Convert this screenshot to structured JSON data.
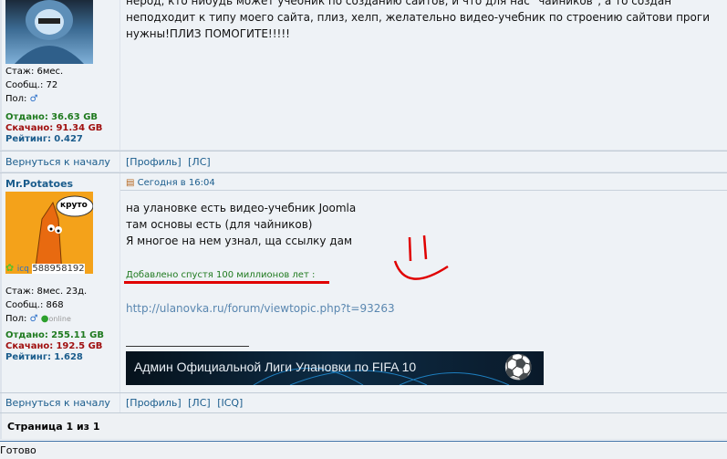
{
  "post1": {
    "text_line1": "нерод, кто нибудь может учебник по созданию сайтов, и что для нас \"чайников\", а то создан",
    "text_line2": "неподходит к типу моего сайта, плиз, хелп, желательно видео-учебник по строению сайтови проги",
    "text_line3": "нужны!ПЛИЗ ПОМОГИТЕ!!!!!",
    "author_stats": {
      "tenure": "Стаж: 6мес.",
      "posts": "Сообщ.: 72",
      "gender_label": "Пол:",
      "uploaded_label": "Отдано:",
      "uploaded_value": "36.63 GB",
      "downloaded_label": "Скачано:",
      "downloaded_value": "91.34 GB",
      "rating_label": "Рейтинг:",
      "rating_value": "0.427"
    },
    "back_to_top": "Вернуться к началу",
    "profile_link": "[Профиль]",
    "pm_link": "[ЛС]"
  },
  "post2": {
    "author": "Mr.Potatoes",
    "date": "Сегодня в 16:04",
    "avatar_bubble": "круто",
    "icq_label": "icq",
    "icq_number": "588958192",
    "line1": "на улановке есть видео-учебник Joomla",
    "line2": "там основы есть (для чайников)",
    "line3": "Я многое на нем узнал, ща ссылку дам",
    "edit_note": "Добавлено спустя 100 миллионов лет :",
    "url": "http://ulanovka.ru/forum/viewtopic.php?t=93263",
    "signature_text": "Админ Официальной Лиги Улановки по FIFA 10",
    "author_stats": {
      "tenure": "Стаж: 8мес. 23д.",
      "posts": "Сообщ.: 868",
      "gender_label": "Пол:",
      "online": "online",
      "uploaded_label": "Отдано:",
      "uploaded_value": "255.11 GB",
      "downloaded_label": "Скачано:",
      "downloaded_value": "192.5 GB",
      "rating_label": "Рейтинг:",
      "rating_value": "1.628"
    },
    "back_to_top": "Вернуться к началу",
    "profile_link": "[Профиль]",
    "pm_link": "[ЛС]",
    "icq_link": "[ICQ]"
  },
  "pagination": "Страница 1 из 1",
  "status_bar": "Готово",
  "colors": {
    "link": "#1a5c8c",
    "uploaded": "#1f7a1f",
    "downloaded": "#a01010",
    "row_bg": "#eef2f6",
    "border": "#c2ccd6"
  }
}
